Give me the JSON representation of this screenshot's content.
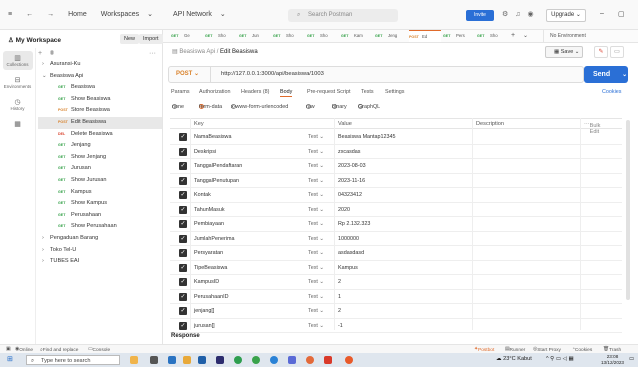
{
  "topbar": {
    "home": "Home",
    "workspaces": "Workspaces",
    "api_network": "API Network",
    "search_placeholder": "Search Postman",
    "invite": "Invite",
    "upgrade": "Upgrade"
  },
  "sidebar": {
    "workspace": "My Workspace",
    "new_label": "New",
    "import_label": "Import",
    "rail": [
      {
        "label": "Collections",
        "icon": "collections-icon"
      },
      {
        "label": "Environments",
        "icon": "environments-icon"
      },
      {
        "label": "History",
        "icon": "history-icon"
      },
      {
        "label": "",
        "icon": "apps-icon"
      }
    ],
    "tree": [
      {
        "type": "folder",
        "label": "Asuransi-Ku",
        "open": false
      },
      {
        "type": "folder",
        "label": "Beasiswa Api",
        "open": true
      },
      {
        "type": "req",
        "method": "GET",
        "label": "Beasiswa"
      },
      {
        "type": "req",
        "method": "GET",
        "label": "Show Beasiswa"
      },
      {
        "type": "req",
        "method": "POST",
        "label": "Store Beasiswa"
      },
      {
        "type": "req",
        "method": "POST",
        "label": "Edit Beasiswa",
        "selected": true
      },
      {
        "type": "req",
        "method": "DEL",
        "label": "Delete Beasiswa"
      },
      {
        "type": "req",
        "method": "GET",
        "label": "Jenjang"
      },
      {
        "type": "req",
        "method": "GET",
        "label": "Show Jenjang"
      },
      {
        "type": "req",
        "method": "GET",
        "label": "Jurusan"
      },
      {
        "type": "req",
        "method": "GET",
        "label": "Show Jurusan"
      },
      {
        "type": "req",
        "method": "GET",
        "label": "Kampus"
      },
      {
        "type": "req",
        "method": "GET",
        "label": "Show Kampus"
      },
      {
        "type": "req",
        "method": "GET",
        "label": "Perusahaan"
      },
      {
        "type": "req",
        "method": "GET",
        "label": "Show Perusahaan"
      },
      {
        "type": "folder",
        "label": "Pengaduan Barang",
        "open": false
      },
      {
        "type": "folder",
        "label": "Toko Tel-U",
        "open": false
      },
      {
        "type": "folder",
        "label": "TUBES EAI",
        "open": false
      }
    ]
  },
  "tabs": [
    {
      "method": "GET",
      "label": "Ge"
    },
    {
      "method": "GET",
      "label": "Sho"
    },
    {
      "method": "GET",
      "label": "Jun"
    },
    {
      "method": "GET",
      "label": "Sho"
    },
    {
      "method": "GET",
      "label": "Sho"
    },
    {
      "method": "GET",
      "label": "Kam"
    },
    {
      "method": "GET",
      "label": "Jeng"
    },
    {
      "method": "POST",
      "label": "Ed",
      "active": true
    },
    {
      "method": "GET",
      "label": "Pers"
    },
    {
      "method": "GET",
      "label": "Sho"
    }
  ],
  "environment": "No Environment",
  "request": {
    "breadcrumb_parent": "Beasiswa Api",
    "breadcrumb_current": "Edit Beasiswa",
    "save": "Save",
    "method": "POST",
    "url": "http://127.0.0.1:3000/api/beasiswa/1003",
    "send": "Send",
    "tabs": [
      "Params",
      "Authorization",
      "Headers (8)",
      "Body",
      "Pre-request Script",
      "Tests",
      "Settings"
    ],
    "active_tab": "Body",
    "cookies": "Cookies",
    "body_types": [
      "none",
      "form-data",
      "x-www-form-urlencoded",
      "raw",
      "binary",
      "GraphQL"
    ],
    "selected_body_type": "form-data"
  },
  "table": {
    "headers": {
      "key": "Key",
      "value": "Value",
      "description": "Description",
      "bulk": "Bulk Edit"
    },
    "rows": [
      {
        "key": "NamaBeasiswa",
        "type": "Text",
        "value": "Beasiswa Mantap12345"
      },
      {
        "key": "Deskripsi",
        "type": "Text",
        "value": "zxcasdas"
      },
      {
        "key": "TanggalPendaftaran",
        "type": "Text",
        "value": "2023-08-03"
      },
      {
        "key": "TanggalPenutupan",
        "type": "Text",
        "value": "2023-11-16"
      },
      {
        "key": "Kontak",
        "type": "Text",
        "value": "04323412"
      },
      {
        "key": "TahunMasuk",
        "type": "Text",
        "value": "2020"
      },
      {
        "key": "Pembiayaan",
        "type": "Text",
        "value": "Rp 2.132.323"
      },
      {
        "key": "JumlahPenerima",
        "type": "Text",
        "value": "1000000"
      },
      {
        "key": "Persyaratan",
        "type": "Text",
        "value": "asdasdasd"
      },
      {
        "key": "TipeBeasiswa",
        "type": "Text",
        "value": "Kampus"
      },
      {
        "key": "KampusID",
        "type": "Text",
        "value": "2"
      },
      {
        "key": "PerusahaanID",
        "type": "Text",
        "value": "1"
      },
      {
        "key": "jenjang[]",
        "type": "Text",
        "value": "2"
      },
      {
        "key": "jurusan[]",
        "type": "Text",
        "value": "-1"
      }
    ]
  },
  "response_label": "Response",
  "statusbar": {
    "online": "Online",
    "find": "Find and replace",
    "console": "Console",
    "postbot": "Postbot",
    "runner": "Runner",
    "proxy": "Start Proxy",
    "cookies": "Cookies",
    "trash": "Trash"
  },
  "taskbar": {
    "search": "Type here to search",
    "weather": "23°C Kabut",
    "time": "23:08",
    "date": "13/12/2023"
  }
}
